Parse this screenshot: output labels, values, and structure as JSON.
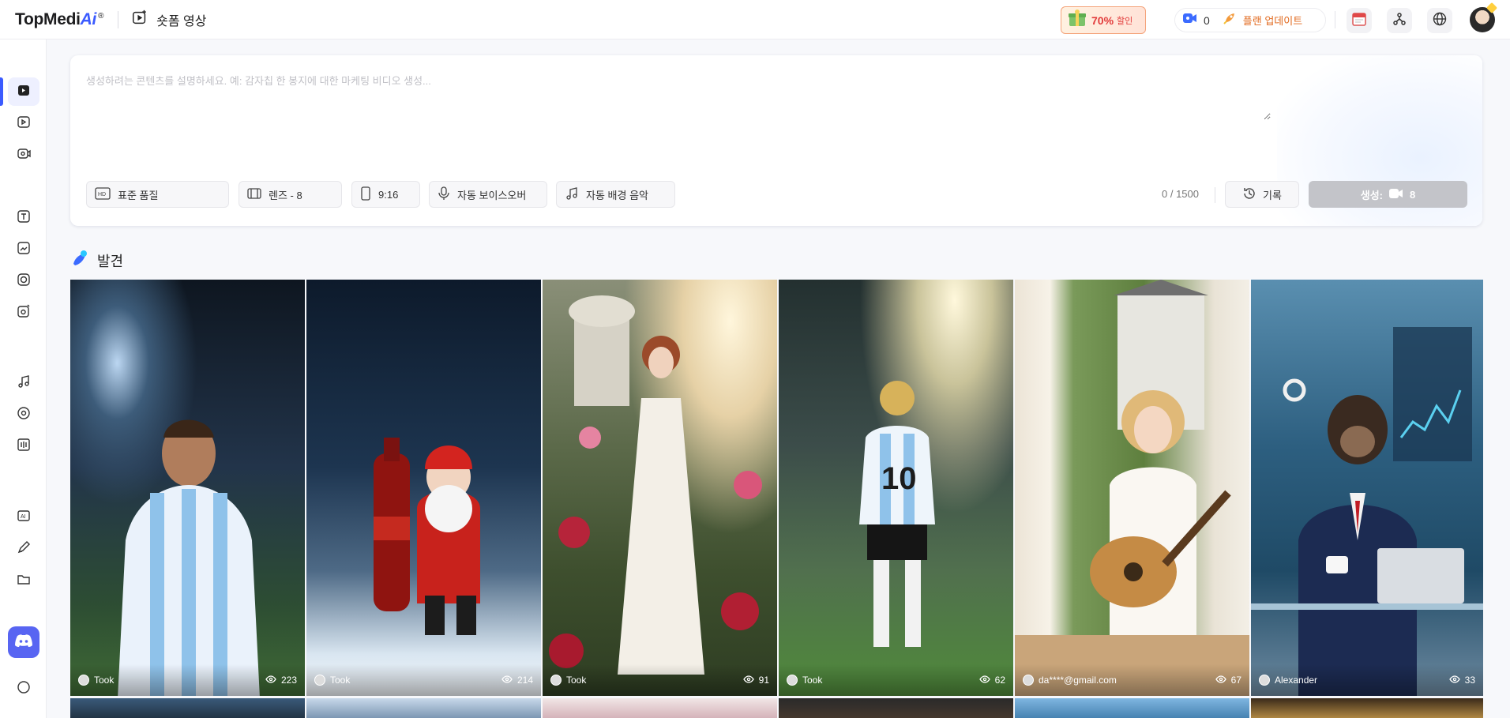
{
  "header": {
    "logo_text": "TopMedi",
    "logo_ai": "Ai",
    "logo_mark": "®",
    "page_title": "숏폼 영상",
    "promo_percent": "70%",
    "promo_label": "할인",
    "credits": "0",
    "upgrade_label": "플랜 업데이트"
  },
  "prompt": {
    "placeholder": "생성하려는 콘텐츠를 설명하세요. 예: 감자칩 한 봉지에 대한 마케팅 비디오 생성...",
    "value": "",
    "quality": "표준 품질",
    "scenes": "렌즈 - 8",
    "ratio": "9:16",
    "voiceover": "자동 보이스오버",
    "music": "자동 배경 음악",
    "char_count": "0 / 1500",
    "history_label": "기록",
    "generate_label": "생성:",
    "generate_cost": "8"
  },
  "discover": {
    "title": "발견",
    "cards": [
      {
        "author": "Took",
        "views": "223"
      },
      {
        "author": "Took",
        "views": "214"
      },
      {
        "author": "Took",
        "views": "91"
      },
      {
        "author": "Took",
        "views": "62"
      },
      {
        "author": "da****@gmail.com",
        "views": "67"
      },
      {
        "author": "Alexander",
        "views": "33"
      }
    ]
  },
  "sidebar": {
    "icons": [
      "short-video-icon",
      "video-icon",
      "avatar-video-icon",
      "text-to-image-icon",
      "image-to-video-icon",
      "face-swap-icon",
      "photo-edit-icon",
      "music-icon",
      "audio-icon",
      "voice-icon",
      "ai-tools-icon",
      "pen-icon",
      "folder-icon",
      "discord-icon",
      "chat-icon"
    ]
  }
}
